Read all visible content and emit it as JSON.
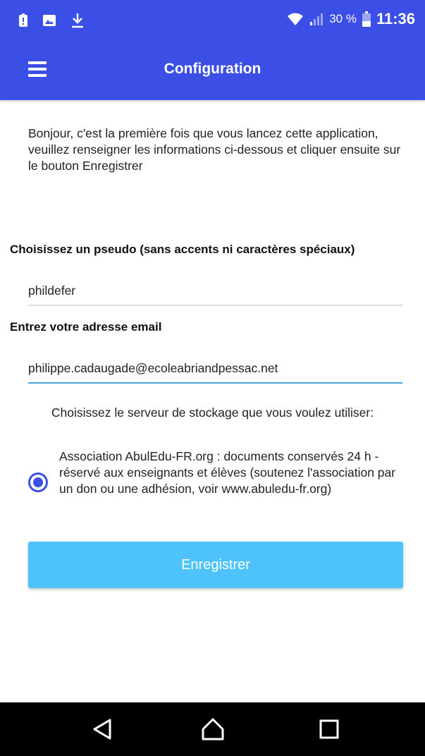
{
  "status_bar": {
    "left_icons": [
      "notification-alert-icon",
      "image-icon",
      "download-icon"
    ],
    "right_icons": [
      "wifi-icon",
      "cellular-signal-icon",
      "battery-icon"
    ],
    "battery_percent": "30 %",
    "clock": "11:36"
  },
  "app_bar": {
    "menu_icon": "hamburger-menu-icon",
    "title": "Configuration"
  },
  "intro_text": "Bonjour, c'est la première fois que vous lancez cette application, veuillez renseigner les informations ci-dessous et cliquer ensuite sur le bouton Enregistrer",
  "pseudo": {
    "label": "Choisissez un pseudo (sans accents ni caractères spéciaux)",
    "value": "phildefer"
  },
  "email": {
    "label": "Entrez votre adresse email",
    "value": "philippe.cadaugade@ecoleabriandpessac.net"
  },
  "server": {
    "prompt": "Choisissez le serveur de stockage que vous voulez utiliser:",
    "options": [
      {
        "label": "Association AbulEdu-FR.org : documents conservés 24 h - réservé aux enseignants et élèves (soutenez l'association par un don ou une adhésion, voir www.abuledu-fr.org)",
        "selected": true
      }
    ]
  },
  "save_button_label": "Enregistrer",
  "nav_bar": {
    "icons": [
      "back-triangle-icon",
      "home-icon",
      "recents-square-icon"
    ]
  },
  "colors": {
    "primary": "#3b4fe6",
    "button": "#4ec3fb",
    "active_underline": "#4aa3df"
  }
}
